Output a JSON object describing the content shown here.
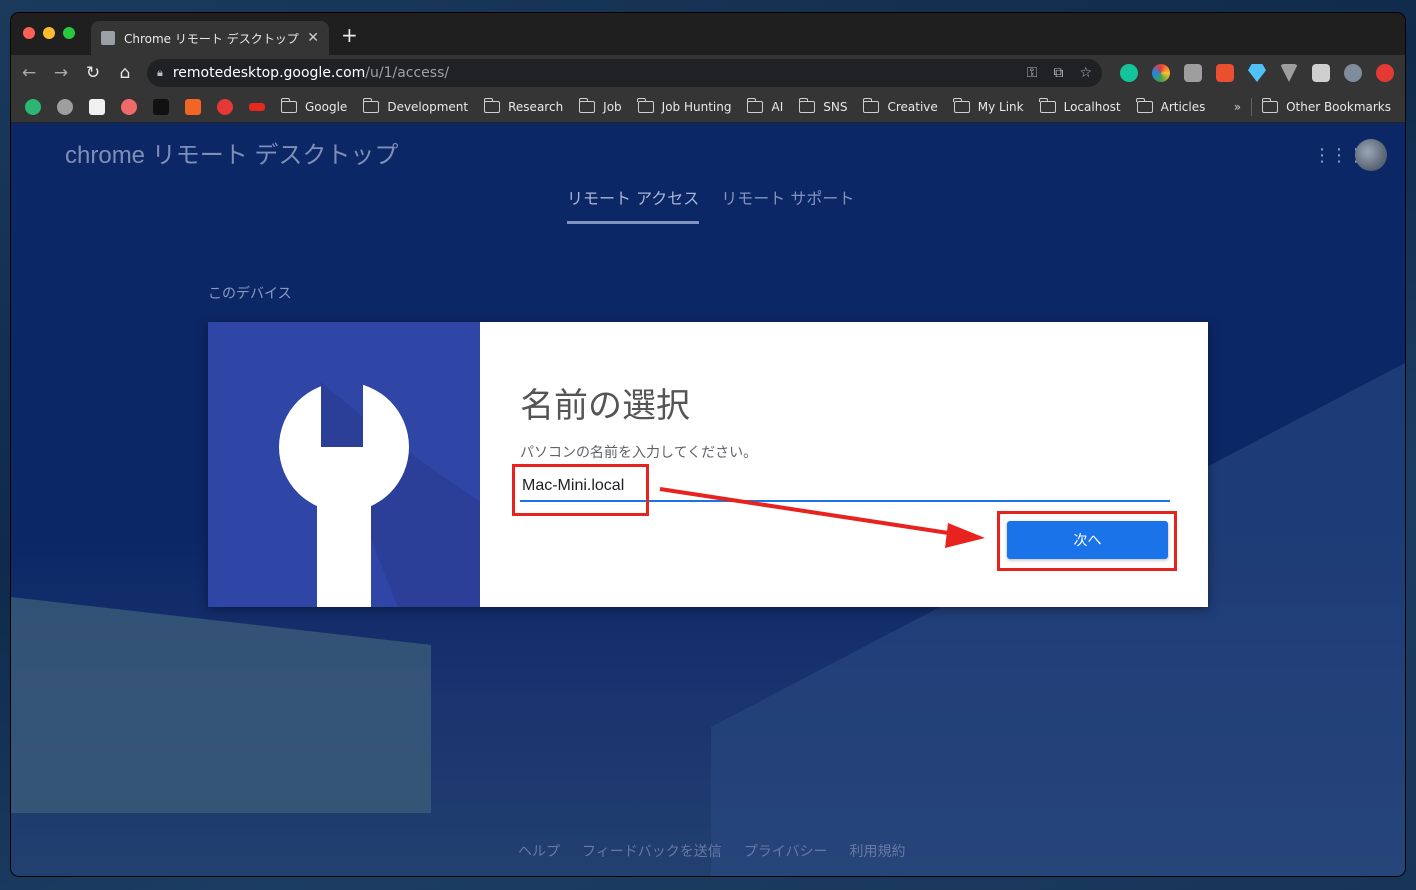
{
  "browser": {
    "tab_title": "Chrome リモート デスクトップ",
    "tab_close": "✕",
    "new_tab": "+",
    "url_host": "remotedesktop.google.com",
    "url_path": "/u/1/access/",
    "bookmarks": [
      "Google",
      "Development",
      "Research",
      "Job",
      "Job Hunting",
      "AI",
      "SNS",
      "Creative",
      "My Link",
      "Localhost",
      "Articles"
    ],
    "bookmarks_overflow": "»",
    "other_bookmarks": "Other Bookmarks"
  },
  "app": {
    "title": "chrome リモート デスクトップ",
    "tabs": [
      "リモート アクセス",
      "リモート サポート"
    ],
    "section_label": "このデバイス"
  },
  "dialog": {
    "title": "名前の選択",
    "prompt": "パソコンの名前を入力してください。",
    "input_value": "Mac-Mini.local",
    "next_label": "次へ"
  },
  "footer": {
    "links": [
      "ヘルプ",
      "フィードバックを送信",
      "プライバシー",
      "利用規約"
    ]
  },
  "colors": {
    "accent": "#1a73e8",
    "highlight": "#e8231f",
    "dialog_left": "#3046a6"
  }
}
